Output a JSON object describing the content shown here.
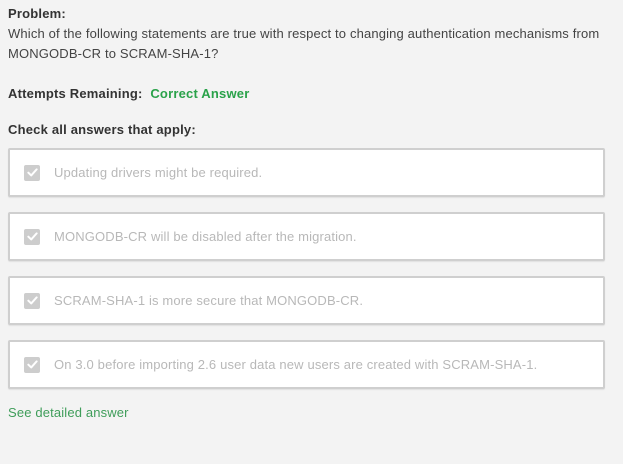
{
  "problem": {
    "label": "Problem:",
    "text": "Which of the following statements are true with respect to changing authentication mechanisms from MONGODB-CR to SCRAM-SHA-1?"
  },
  "attempts": {
    "label": "Attempts Remaining:",
    "value": "Correct Answer"
  },
  "instructions": "Check all answers that apply:",
  "answers": [
    {
      "text": "Updating drivers might be required.",
      "checked": true
    },
    {
      "text": "MONGODB-CR will be disabled after the migration.",
      "checked": true
    },
    {
      "text": "SCRAM-SHA-1 is more secure that MONGODB-CR.",
      "checked": true
    },
    {
      "text": "On 3.0 before importing 2.6 user data new users are created with SCRAM-SHA-1.",
      "checked": true
    }
  ],
  "detail_link": "See detailed answer",
  "colors": {
    "correct": "#2aa24a",
    "link": "#3f9d5a",
    "disabled_text": "#b8b8b8",
    "checkbox": "#cdcdcd"
  },
  "icons": {
    "check": "checkmark-icon"
  }
}
